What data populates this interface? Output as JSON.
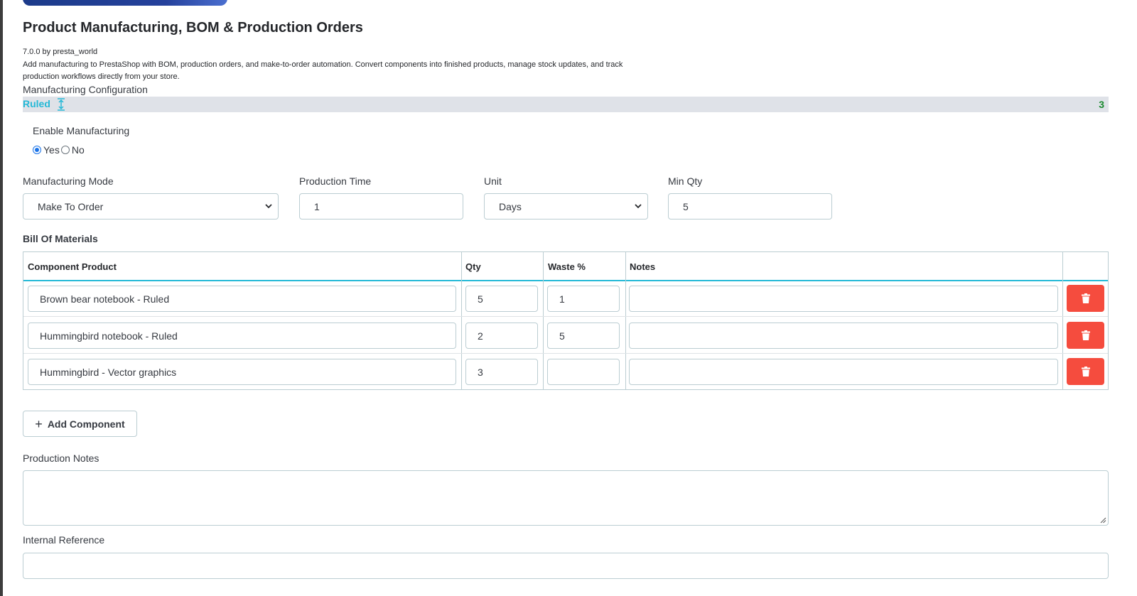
{
  "module": {
    "title": "Product Manufacturing, BOM & Production Orders",
    "version_line": "7.0.0 by presta_world",
    "description": "Add manufacturing to PrestaShop with BOM, production orders, and make-to-order automation. Convert components into finished products, manage stock updates, and track production workflows directly from your store."
  },
  "config": {
    "section_label": "Manufacturing Configuration",
    "combination": {
      "name": "Ruled",
      "count": "3",
      "icon": "expand-collapse-icon"
    }
  },
  "enable": {
    "label": "Enable Manufacturing",
    "yes_label": "Yes",
    "no_label": "No",
    "selected": "Yes"
  },
  "fields": {
    "mode": {
      "label": "Manufacturing Mode",
      "value": "Make To Order"
    },
    "production_time": {
      "label": "Production Time",
      "value": "1"
    },
    "unit": {
      "label": "Unit",
      "value": "Days"
    },
    "min_qty": {
      "label": "Min Qty",
      "value": "5"
    }
  },
  "bom": {
    "label": "Bill Of Materials",
    "columns": [
      "Component Product",
      "Qty",
      "Waste %",
      "Notes"
    ],
    "rows": [
      {
        "product": "Brown bear notebook - Ruled",
        "qty": "5",
        "waste": "1",
        "notes": ""
      },
      {
        "product": "Hummingbird notebook - Ruled",
        "qty": "2",
        "waste": "5",
        "notes": ""
      },
      {
        "product": "Hummingbird - Vector graphics",
        "qty": "3",
        "waste": "",
        "notes": ""
      }
    ],
    "delete_icon": "trash-icon",
    "add_label": "Add Component"
  },
  "production_notes": {
    "label": "Production Notes",
    "value": ""
  },
  "internal_reference": {
    "label": "Internal Reference",
    "value": ""
  },
  "colors": {
    "accent": "#25b9d7",
    "danger": "#f54c3e",
    "count_green": "#1a8a2e",
    "radio_blue": "#1a73e8"
  }
}
